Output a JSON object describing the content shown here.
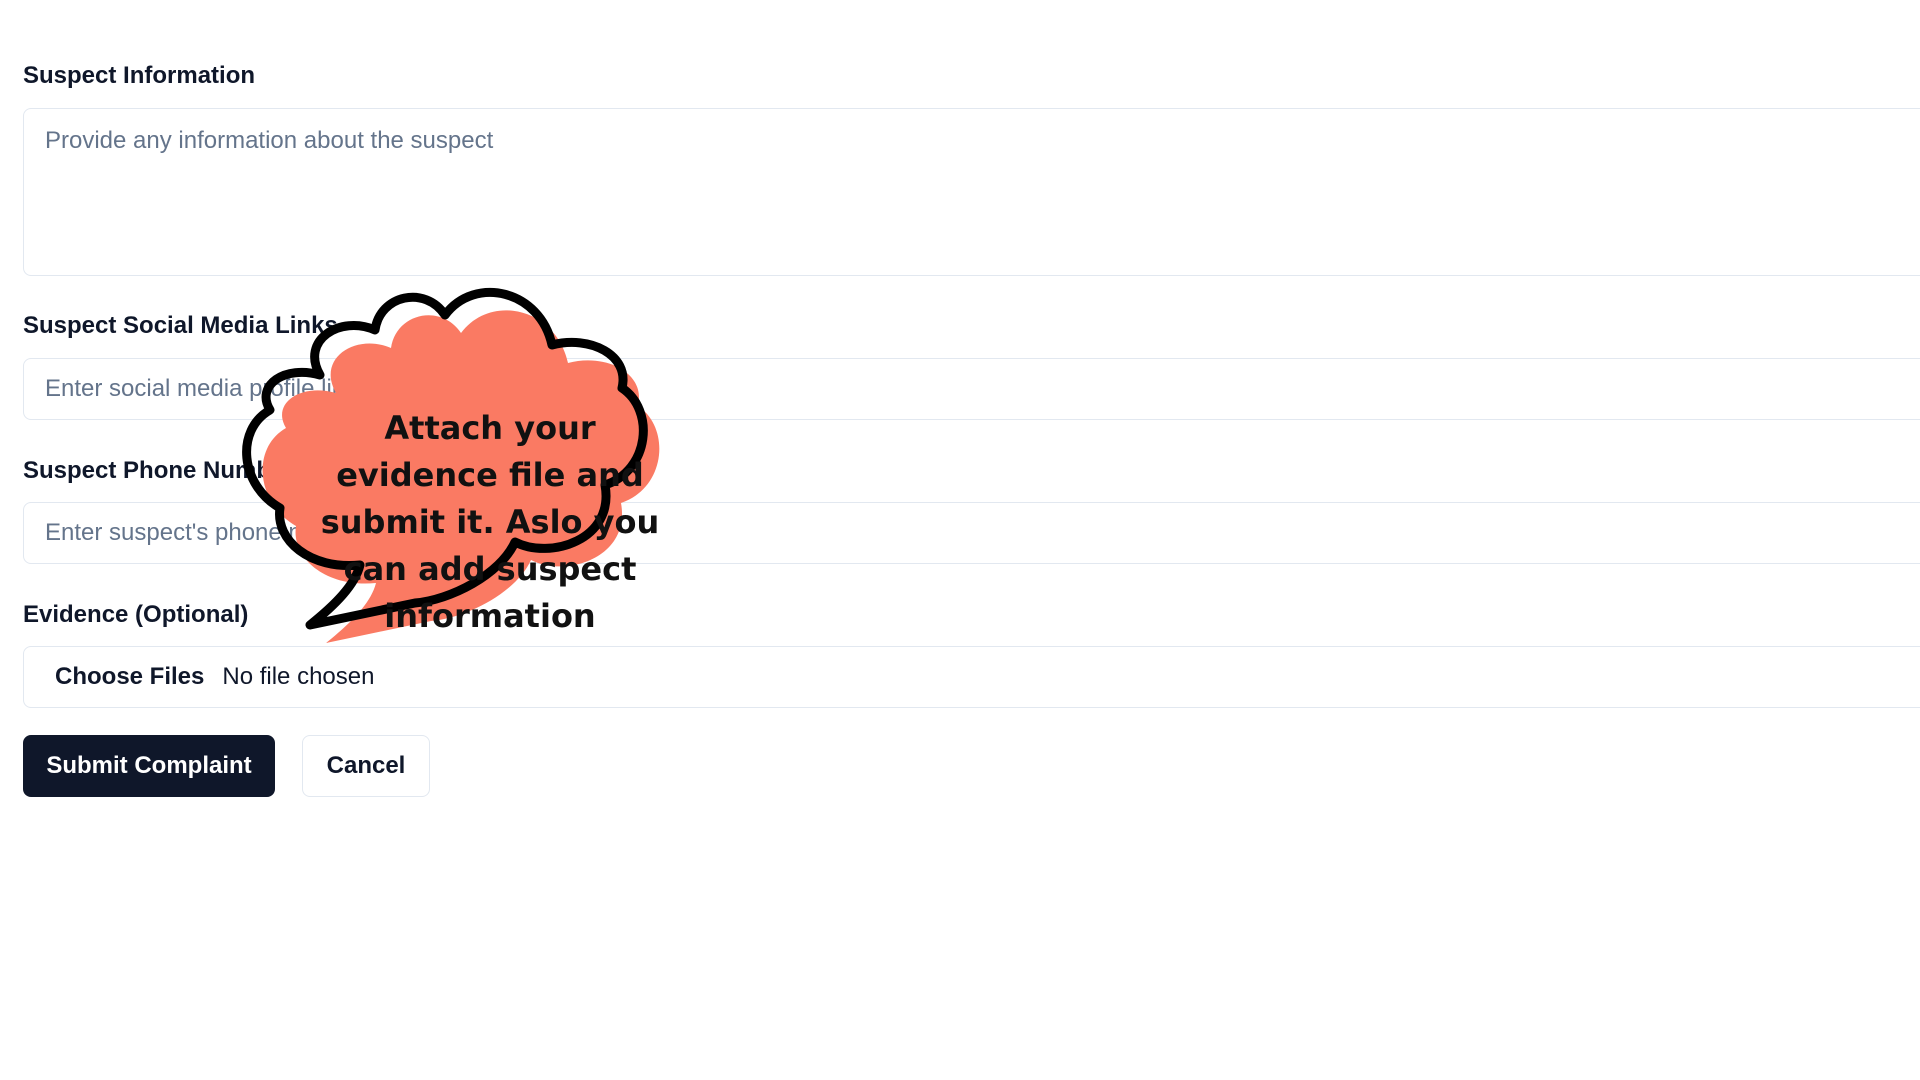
{
  "form": {
    "suspect_info": {
      "label": "Suspect Information",
      "placeholder": "Provide any information about the suspect"
    },
    "social_links": {
      "label": "Suspect Social Media Links",
      "placeholder": "Enter social media profile links"
    },
    "phone": {
      "label": "Suspect Phone Number",
      "placeholder": "Enter suspect's phone number"
    },
    "evidence": {
      "label": "Evidence (Optional)",
      "choose_label": "Choose Files",
      "status": "No file chosen"
    },
    "actions": {
      "submit_label": "Submit Complaint",
      "cancel_label": "Cancel"
    }
  },
  "callout": {
    "text": "Attach your evidence file and submit it. Aslo you can add suspect information",
    "fill_color": "#fa7a63",
    "outline_color": "#000000"
  },
  "colors": {
    "primary": "#0f172a",
    "border": "#e2e8f0",
    "placeholder": "#64748b"
  }
}
